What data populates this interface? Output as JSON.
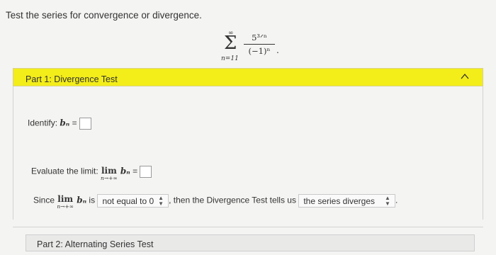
{
  "prompt": "Test the series for convergence or divergence.",
  "series": {
    "sup": "∞",
    "sigma": "Σ",
    "sub": "n=11",
    "numerator": "5³ᐟⁿ",
    "denominator": "(−1)ⁿ",
    "end": "."
  },
  "part1": {
    "title": "Part 1: Divergence Test",
    "identify_label": "Identify: ",
    "identify_var": "bₙ",
    "identify_eq": " = ",
    "evaluate_label": "Evaluate the limit: ",
    "lim_word": "lim",
    "lim_sub": "n→+∞",
    "lim_var": " bₙ",
    "lim_eq": " = ",
    "since_label": "Since ",
    "since_var": " bₙ",
    "since_is": " is ",
    "dropdown1_value": "not equal to 0",
    "then_text": ", then the Divergence Test tells us ",
    "dropdown2_value": "the series diverges",
    "dropdown2_end": "."
  },
  "part2": {
    "title": "Part 2: Alternating Series Test"
  },
  "colors": {
    "part1_header": "#f3ed1a"
  }
}
